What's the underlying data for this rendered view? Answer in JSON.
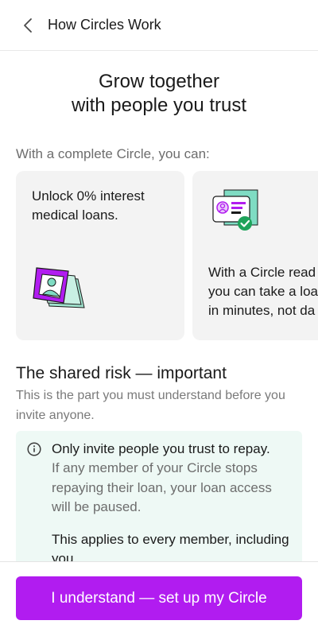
{
  "header": {
    "title": "How Circles Work",
    "back_icon": "chevron-left-icon"
  },
  "hero": {
    "title_line1": "Grow together",
    "title_line2": "with people you trust"
  },
  "intro": "With a complete Circle, you can:",
  "cards": [
    {
      "line1": "Unlock 0% interest",
      "line2": "medical loans.",
      "icon": "medical-card-illustration"
    },
    {
      "line1": "With a Circle read",
      "line2": "you can take a loa",
      "line3": "in minutes, not da",
      "icon": "verified-id-card-illustration"
    }
  ],
  "risk": {
    "title": "The shared risk — important",
    "subtitle": "This is the part you must understand before you invite anyone."
  },
  "notice": {
    "icon": "info-icon",
    "lead": "Only invite people you trust to repay.",
    "body": "If any member of your Circle stops repaying their loan, your loan access will be paused.",
    "body2": "This applies to every member, including you."
  },
  "cta": {
    "label": "I understand — set up my Circle"
  },
  "colors": {
    "accent": "#b11cf0",
    "notice_bg": "#eef9f5",
    "card_bg": "#f3f3f3",
    "success": "#1ea35a"
  }
}
